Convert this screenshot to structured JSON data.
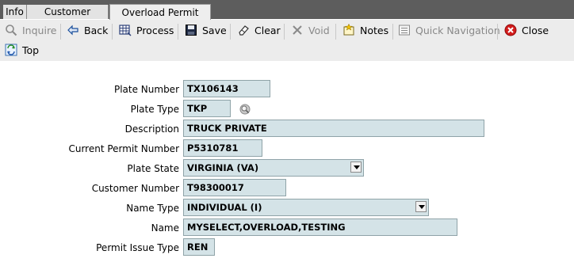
{
  "tabs": [
    {
      "label": "Info"
    },
    {
      "label": "Customer Console"
    },
    {
      "label": "Overload Permit Renew",
      "active": true
    }
  ],
  "toolbar": {
    "inquire": "Inquire",
    "back": "Back",
    "process": "Process",
    "save": "Save",
    "clear": "Clear",
    "void": "Void",
    "notes": "Notes",
    "quick_navigation": "Quick Navigation",
    "close": "Close",
    "top": "Top"
  },
  "form": {
    "plate_number": {
      "label": "Plate Number",
      "value": "TX106143"
    },
    "plate_type": {
      "label": "Plate Type",
      "value": "TKP"
    },
    "description": {
      "label": "Description",
      "value": "TRUCK PRIVATE"
    },
    "current_permit_number": {
      "label": "Current Permit Number",
      "value": "P5310781"
    },
    "plate_state": {
      "label": "Plate State",
      "value": "VIRGINIA (VA)"
    },
    "customer_number": {
      "label": "Customer Number",
      "value": "T98300017"
    },
    "name_type": {
      "label": "Name Type",
      "value": "INDIVIDUAL (I)"
    },
    "name": {
      "label": "Name",
      "value": "MYSELECT,OVERLOAD,TESTING"
    },
    "permit_issue_type": {
      "label": "Permit Issue Type",
      "value": "REN"
    }
  }
}
